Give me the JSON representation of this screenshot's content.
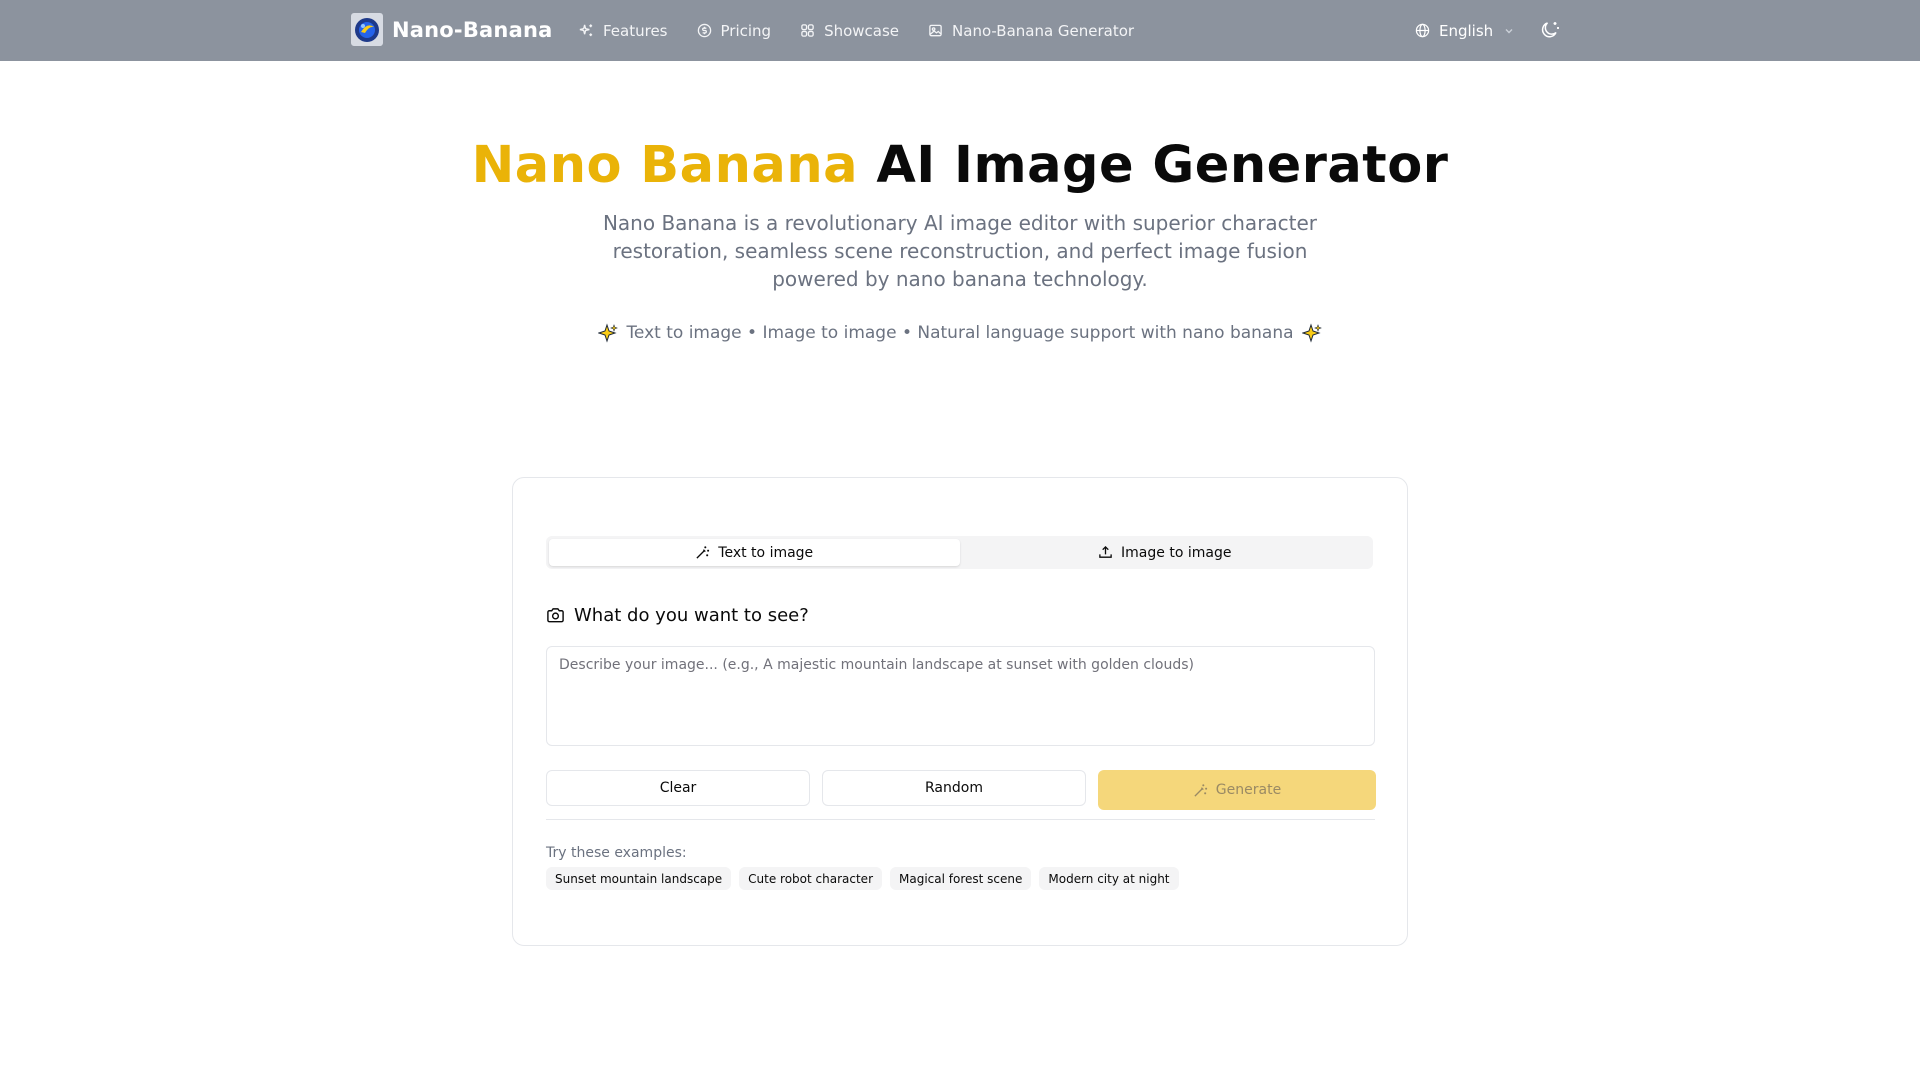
{
  "header": {
    "brand_name": "Nano-Banana",
    "nav": [
      {
        "label": "Features",
        "icon": "sparkles-icon"
      },
      {
        "label": "Pricing",
        "icon": "coin-icon"
      },
      {
        "label": "Showcase",
        "icon": "grid-icon"
      },
      {
        "label": "Nano-Banana Generator",
        "icon": "image-icon"
      }
    ],
    "language": "English",
    "theme_icon": "moon-icon"
  },
  "hero": {
    "title_accent": "Nano Banana",
    "title_rest": "AI Image Generator",
    "subtitle": "Nano Banana is a revolutionary AI image editor with superior character restoration, seamless scene reconstruction, and perfect image fusion powered by nano banana technology.",
    "features_line": "Text to image • Image to image • Natural language support with nano banana"
  },
  "generator": {
    "tabs": [
      {
        "label": "Text to image",
        "icon": "magic-wand-icon",
        "active": true
      },
      {
        "label": "Image to image",
        "icon": "upload-icon",
        "active": false
      }
    ],
    "prompt_label": "What do you want to see?",
    "prompt_placeholder": "Describe your image... (e.g., A majestic mountain landscape at sunset with golden clouds)",
    "prompt_value": "",
    "buttons": {
      "clear": "Clear",
      "random": "Random",
      "generate": "Generate"
    },
    "examples_label": "Try these examples:",
    "examples": [
      "Sunset mountain landscape",
      "Cute robot character",
      "Magical forest scene",
      "Modern city at night"
    ]
  },
  "colors": {
    "header_bg": "#8c939e",
    "accent": "#eab308",
    "generate_bg": "#f5d77b"
  }
}
